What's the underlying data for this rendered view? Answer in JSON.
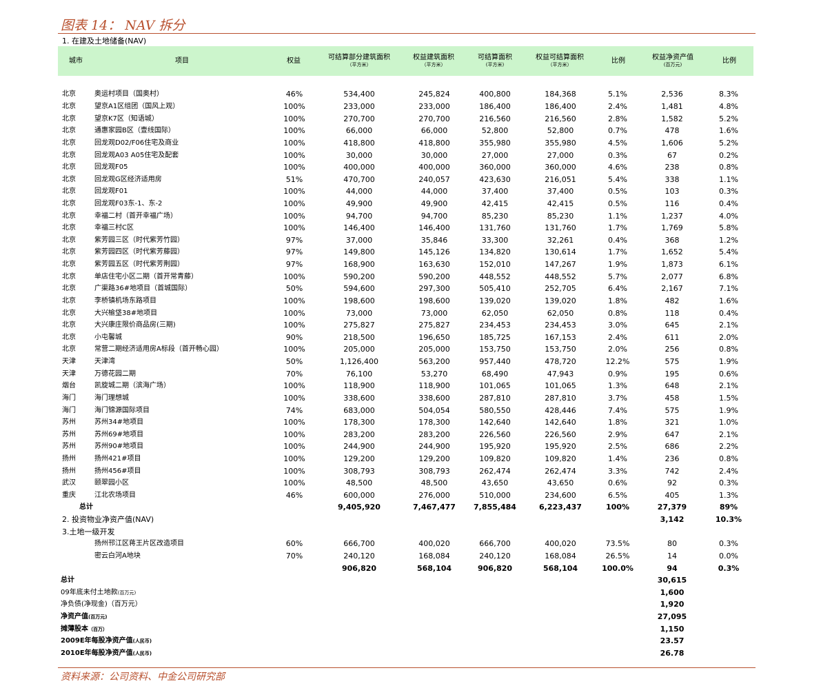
{
  "title": "图表 14： NAV 拆分",
  "section1": "1. 在建及土地储备(NAV)",
  "section2": "2. 投资物业净资产值(NAV)",
  "section3": "3.土地一级开发",
  "headers": {
    "city": "城市",
    "project": "项目",
    "equity": "权益",
    "sellable_gfa": "可结算部分建筑面积",
    "sellable_gfa_unit": "（平方米）",
    "equity_gfa": "权益建筑面积",
    "equity_gfa_unit": "（平方米）",
    "sellable_area": "可结算面积",
    "sellable_area_unit": "(平方米)",
    "equity_sellable_area": "权益可结算面积",
    "equity_sellable_area_unit": "（平方米）",
    "ratio": "比例",
    "equity_nav": "权益净资产值",
    "equity_nav_unit": "(百万元)",
    "ratio2": "比例"
  },
  "rows": [
    [
      "北京",
      "奥运村项目（国奥村）",
      "46%",
      "534,400",
      "245,824",
      "400,800",
      "184,368",
      "5.1%",
      "2,536",
      "8.3%"
    ],
    [
      "北京",
      "望京A1区组团（国风上观）",
      "100%",
      "233,000",
      "233,000",
      "186,400",
      "186,400",
      "2.4%",
      "1,481",
      "4.8%"
    ],
    [
      "北京",
      "望京K7区（知语城）",
      "100%",
      "270,700",
      "270,700",
      "216,560",
      "216,560",
      "2.8%",
      "1,582",
      "5.2%"
    ],
    [
      "北京",
      "通惠家园B区（壹线国际）",
      "100%",
      "66,000",
      "66,000",
      "52,800",
      "52,800",
      "0.7%",
      "478",
      "1.6%"
    ],
    [
      "北京",
      "回龙观D02/F06住宅及商业",
      "100%",
      "418,800",
      "418,800",
      "355,980",
      "355,980",
      "4.5%",
      "1,606",
      "5.2%"
    ],
    [
      "北京",
      "回龙观A03 A05住宅及配套",
      "100%",
      "30,000",
      "30,000",
      "27,000",
      "27,000",
      "0.3%",
      "67",
      "0.2%"
    ],
    [
      "北京",
      "回龙观F05",
      "100%",
      "400,000",
      "400,000",
      "360,000",
      "360,000",
      "4.6%",
      "238",
      "0.8%"
    ],
    [
      "北京",
      "回龙观G区经济适用房",
      "51%",
      "470,700",
      "240,057",
      "423,630",
      "216,051",
      "5.4%",
      "338",
      "1.1%"
    ],
    [
      "北京",
      "回龙观F01",
      "100%",
      "44,000",
      "44,000",
      "37,400",
      "37,400",
      "0.5%",
      "103",
      "0.3%"
    ],
    [
      "北京",
      "回龙观F03东-1、东-2",
      "100%",
      "49,900",
      "49,900",
      "42,415",
      "42,415",
      "0.5%",
      "116",
      "0.4%"
    ],
    [
      "北京",
      "幸福二村（首开幸福广场）",
      "100%",
      "94,700",
      "94,700",
      "85,230",
      "85,230",
      "1.1%",
      "1,237",
      "4.0%"
    ],
    [
      "北京",
      "幸福三村C区",
      "100%",
      "146,400",
      "146,400",
      "131,760",
      "131,760",
      "1.7%",
      "1,769",
      "5.8%"
    ],
    [
      "北京",
      "紫芳园三区（时代紫芳竹园）",
      "97%",
      "37,000",
      "35,846",
      "33,300",
      "32,261",
      "0.4%",
      "368",
      "1.2%"
    ],
    [
      "北京",
      "紫芳园四区（时代紫芳藤园）",
      "97%",
      "149,800",
      "145,126",
      "134,820",
      "130,614",
      "1.7%",
      "1,652",
      "5.4%"
    ],
    [
      "北京",
      "紫芳园五区（时代紫芳荆园）",
      "97%",
      "168,900",
      "163,630",
      "152,010",
      "147,267",
      "1.9%",
      "1,873",
      "6.1%"
    ],
    [
      "北京",
      "单店住宅小区二期（首开常青藤）",
      "100%",
      "590,200",
      "590,200",
      "448,552",
      "448,552",
      "5.7%",
      "2,077",
      "6.8%"
    ],
    [
      "北京",
      "广渠路36#地项目（首城国际）",
      "50%",
      "594,600",
      "297,300",
      "505,410",
      "252,705",
      "6.4%",
      "2,167",
      "7.1%"
    ],
    [
      "北京",
      "李桥镇机场东路项目",
      "100%",
      "198,600",
      "198,600",
      "139,020",
      "139,020",
      "1.8%",
      "482",
      "1.6%"
    ],
    [
      "北京",
      "大兴榆垡38#地项目",
      "100%",
      "73,000",
      "73,000",
      "62,050",
      "62,050",
      "0.8%",
      "118",
      "0.4%"
    ],
    [
      "北京",
      "大兴康庄限价商品房(三期)",
      "100%",
      "275,827",
      "275,827",
      "234,453",
      "234,453",
      "3.0%",
      "645",
      "2.1%"
    ],
    [
      "北京",
      "小屯馨城",
      "90%",
      "218,500",
      "196,650",
      "185,725",
      "167,153",
      "2.4%",
      "611",
      "2.0%"
    ],
    [
      "北京",
      "常营二期经济适用房A标段（首开畅心园）",
      "100%",
      "205,000",
      "205,000",
      "153,750",
      "153,750",
      "2.0%",
      "256",
      "0.8%"
    ],
    [
      "天津",
      "天津湾",
      "50%",
      "1,126,400",
      "563,200",
      "957,440",
      "478,720",
      "12.2%",
      "575",
      "1.9%"
    ],
    [
      "天津",
      "万德花园二期",
      "70%",
      "76,100",
      "53,270",
      "68,490",
      "47,943",
      "0.9%",
      "195",
      "0.6%"
    ],
    [
      "烟台",
      "凯旋城二期（滨海广场）",
      "100%",
      "118,900",
      "118,900",
      "101,065",
      "101,065",
      "1.3%",
      "648",
      "2.1%"
    ],
    [
      "海门",
      "海门理想城",
      "100%",
      "338,600",
      "338,600",
      "287,810",
      "287,810",
      "3.7%",
      "458",
      "1.5%"
    ],
    [
      "海门",
      "海门锦源国际项目",
      "74%",
      "683,000",
      "504,054",
      "580,550",
      "428,446",
      "7.4%",
      "575",
      "1.9%"
    ],
    [
      "苏州",
      "苏州34#地项目",
      "100%",
      "178,300",
      "178,300",
      "142,640",
      "142,640",
      "1.8%",
      "321",
      "1.0%"
    ],
    [
      "苏州",
      "苏州69#地项目",
      "100%",
      "283,200",
      "283,200",
      "226,560",
      "226,560",
      "2.9%",
      "647",
      "2.1%"
    ],
    [
      "苏州",
      "苏州90#地项目",
      "100%",
      "244,900",
      "244,900",
      "195,920",
      "195,920",
      "2.5%",
      "686",
      "2.2%"
    ],
    [
      "扬州",
      "扬州421#项目",
      "100%",
      "129,200",
      "129,200",
      "109,820",
      "109,820",
      "1.4%",
      "236",
      "0.8%"
    ],
    [
      "扬州",
      "扬州456#项目",
      "100%",
      "308,793",
      "308,793",
      "262,474",
      "262,474",
      "3.3%",
      "742",
      "2.4%"
    ],
    [
      "武汉",
      "颐翠园小区",
      "100%",
      "48,500",
      "48,500",
      "43,650",
      "43,650",
      "0.6%",
      "92",
      "0.3%"
    ],
    [
      "重庆",
      "江北农场项目",
      "46%",
      "600,000",
      "276,000",
      "510,000",
      "234,600",
      "6.5%",
      "405",
      "1.3%"
    ]
  ],
  "subtotal1": {
    "label": "总计",
    "v1": "9,405,920",
    "v2": "7,467,477",
    "v3": "7,855,484",
    "v4": "6,223,437",
    "ratio": "100%",
    "nav": "27,379",
    "ratio2": "89%"
  },
  "nav2": {
    "nav": "3,142",
    "ratio2": "10.3%"
  },
  "land_rows": [
    [
      "扬州邗江区蒋王片区改造项目",
      "60%",
      "666,700",
      "400,020",
      "666,700",
      "400,020",
      "73.5%",
      "80",
      "0.3%"
    ],
    [
      "密云白河A地块",
      "70%",
      "240,120",
      "168,084",
      "240,120",
      "168,084",
      "26.5%",
      "14",
      "0.0%"
    ]
  ],
  "subtotal3": {
    "v1": "906,820",
    "v2": "568,104",
    "v3": "906,820",
    "v4": "568,104",
    "ratio": "100.0%",
    "nav": "94",
    "ratio2": "0.3%"
  },
  "summary": [
    {
      "label": "总计",
      "unit": "",
      "value": "30,615",
      "bold": true
    },
    {
      "label": "09年底未付土地款",
      "unit": "(百万元)",
      "value": "1,600",
      "bold": false
    },
    {
      "label": "净负债(净现金)（百万元）",
      "unit": "",
      "value": "1,920",
      "bold": false
    },
    {
      "label": "净资产值",
      "unit": "(百万元)",
      "value": "27,095",
      "bold": true
    },
    {
      "label": "摊薄股本",
      "unit": "（百万）",
      "value": "1,150",
      "bold": true
    },
    {
      "label": "2009E年每股净资产值",
      "unit": "(人民币)",
      "value": "23.57",
      "bold": true
    },
    {
      "label": "2010E年每股净资产值",
      "unit": "(人民币)",
      "value": "26.78",
      "bold": true
    }
  ],
  "footer": "资料来源：公司资料、中金公司研究部"
}
